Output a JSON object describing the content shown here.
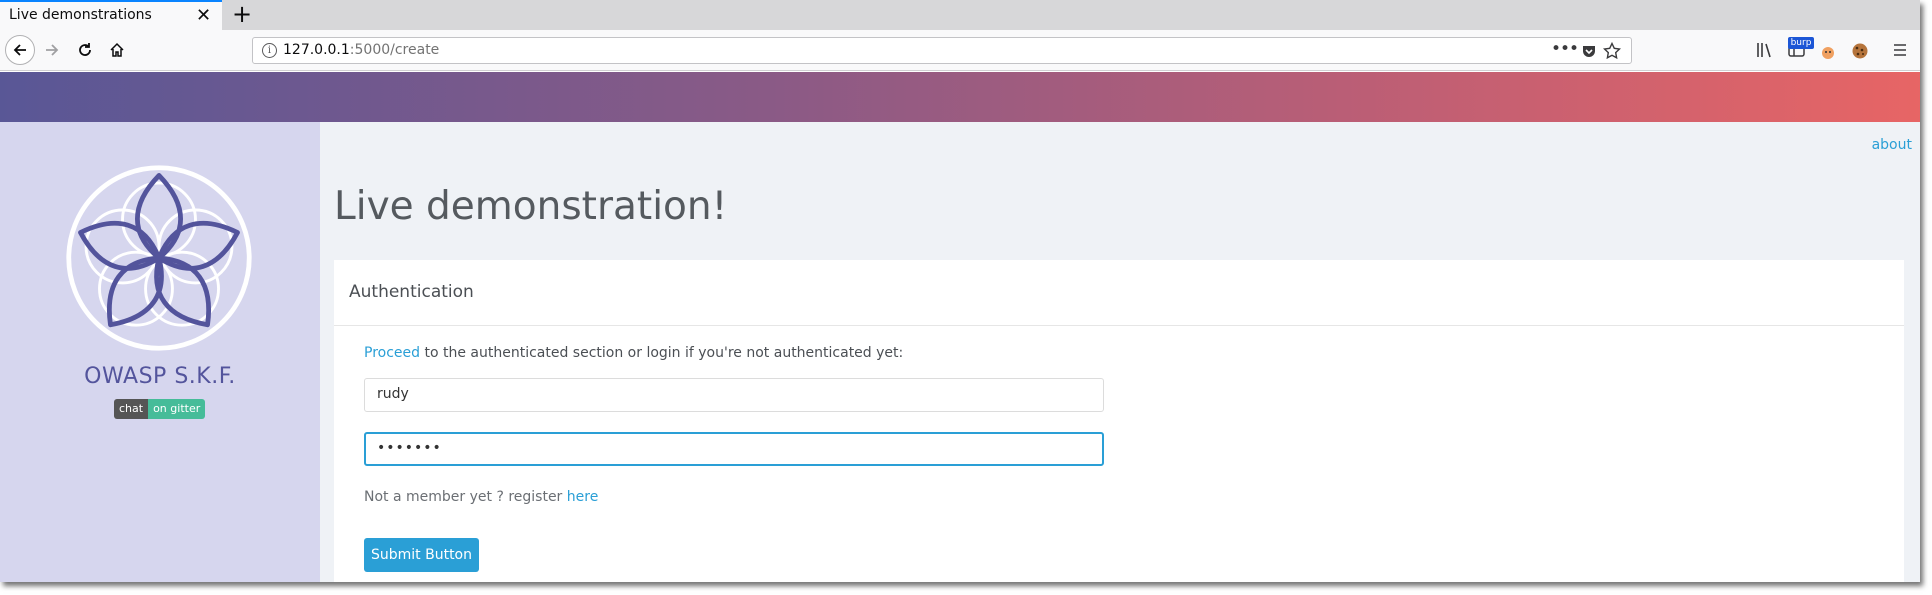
{
  "browser": {
    "tab_title": "Live demonstrations",
    "tab_close": "✕",
    "new_tab": "+",
    "url_host": "127.0.0.1",
    "url_path": ":5000/create",
    "burp_badge": "burp",
    "accent_color": "#0a84ff"
  },
  "sidebar": {
    "brand": "OWASP S.K.F.",
    "gitter_left": "chat",
    "gitter_right": "on gitter",
    "brand_color": "#53549c"
  },
  "header": {
    "about_link": "about",
    "page_title": "Live demonstration!"
  },
  "auth_panel": {
    "title": "Authentication",
    "proceed_link": "Proceed",
    "intro_rest": " to the authenticated section or login if you're not authenticated yet:",
    "username_value": "rudy",
    "password_value": "•••••••",
    "register_prefix": "Not a member yet ? register ",
    "register_link": "here",
    "submit_label": "Submit Button",
    "link_color": "#2a9fd6"
  }
}
